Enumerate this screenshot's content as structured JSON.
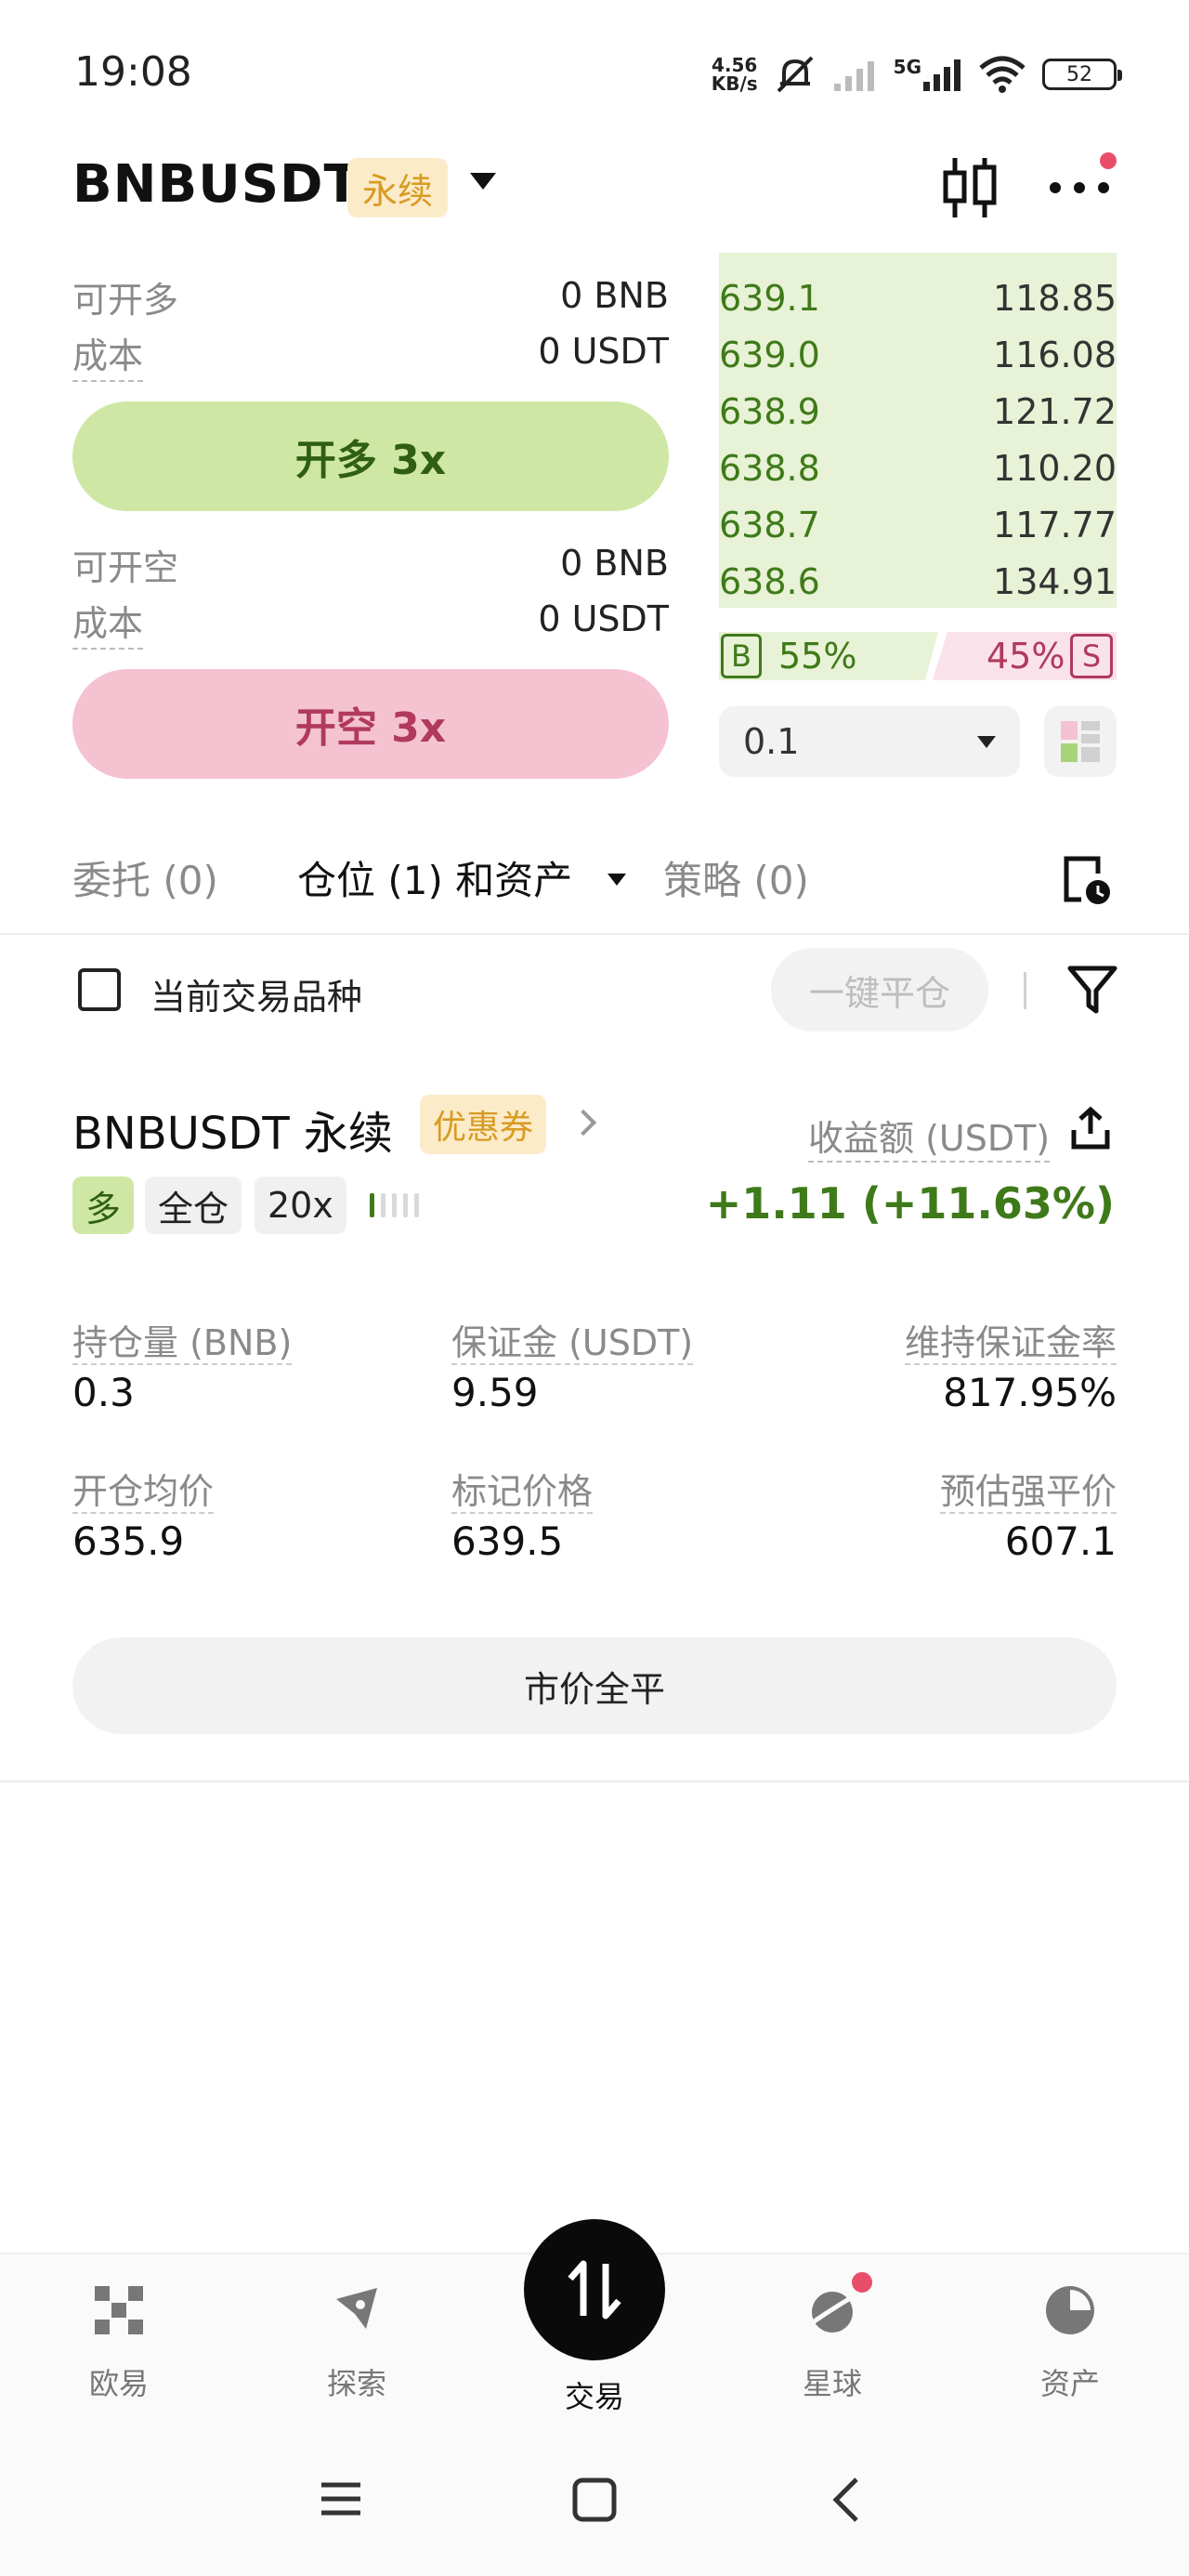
{
  "status_bar": {
    "time": "19:08",
    "net_speed_value": "4.56",
    "net_speed_unit": "KB/s",
    "network": "5G",
    "battery": "52"
  },
  "header": {
    "symbol": "BNBUSDT",
    "contract_type": "永续",
    "icons": [
      "candlestick-chart-icon",
      "more-icon"
    ]
  },
  "trade_panel": {
    "long": {
      "available_label": "可开多",
      "available_value": "0 BNB",
      "cost_label": "成本",
      "cost_value": "0 USDT",
      "button_label": "开多 3x"
    },
    "short": {
      "available_label": "可开空",
      "available_value": "0 BNB",
      "cost_label": "成本",
      "cost_value": "0 USDT",
      "button_label": "开空 3x"
    }
  },
  "order_book": {
    "bids": [
      {
        "price": "639.1",
        "size": "118.85"
      },
      {
        "price": "639.0",
        "size": "116.08"
      },
      {
        "price": "638.9",
        "size": "121.72"
      },
      {
        "price": "638.8",
        "size": "110.20"
      },
      {
        "price": "638.7",
        "size": "117.77"
      },
      {
        "price": "638.6",
        "size": "134.91"
      }
    ],
    "buy_label": "B",
    "buy_ratio": "55%",
    "sell_label": "S",
    "sell_ratio": "45%",
    "depth_step": "0.1"
  },
  "tabs": {
    "orders": "委托 (0)",
    "positions": "仓位 (1) 和资产",
    "strategies": "策略 (0)"
  },
  "filter": {
    "current_symbol_label": "当前交易品种",
    "current_symbol_checked": false,
    "close_all_button": "一键平仓"
  },
  "position": {
    "symbol": "BNBUSDT 永续",
    "coupon_badge": "优惠券",
    "pnl_label": "收益额 (USDT)",
    "side": "多",
    "margin_mode": "全仓",
    "leverage": "20x",
    "risk_level": 0.2,
    "pnl_value": "+1.11 (+11.63%)",
    "stats": {
      "size_label": "持仓量 (BNB)",
      "size_value": "0.3",
      "margin_label": "保证金 (USDT)",
      "margin_value": "9.59",
      "mmr_label": "维持保证金率",
      "mmr_value": "817.95%",
      "entry_label": "开仓均价",
      "entry_value": "635.9",
      "mark_label": "标记价格",
      "mark_value": "639.5",
      "liq_label": "预估强平价",
      "liq_value": "607.1"
    },
    "market_close_button": "市价全平"
  },
  "bottom_nav": {
    "items": [
      {
        "label": "欧易",
        "icon": "okx-logo-icon"
      },
      {
        "label": "探索",
        "icon": "compass-icon"
      },
      {
        "label": "交易",
        "icon": "trade-swap-icon"
      },
      {
        "label": "星球",
        "icon": "planet-icon"
      },
      {
        "label": "资产",
        "icon": "pie-chart-icon"
      }
    ],
    "active": "交易"
  },
  "colors": {
    "long_green": "#3f7a1a",
    "long_bg": "#cfe7a4",
    "short_pink": "#b03a5e",
    "short_bg": "#f5c2d2",
    "badge_orange": "#d89b22",
    "badge_bg": "#fbebc9"
  }
}
